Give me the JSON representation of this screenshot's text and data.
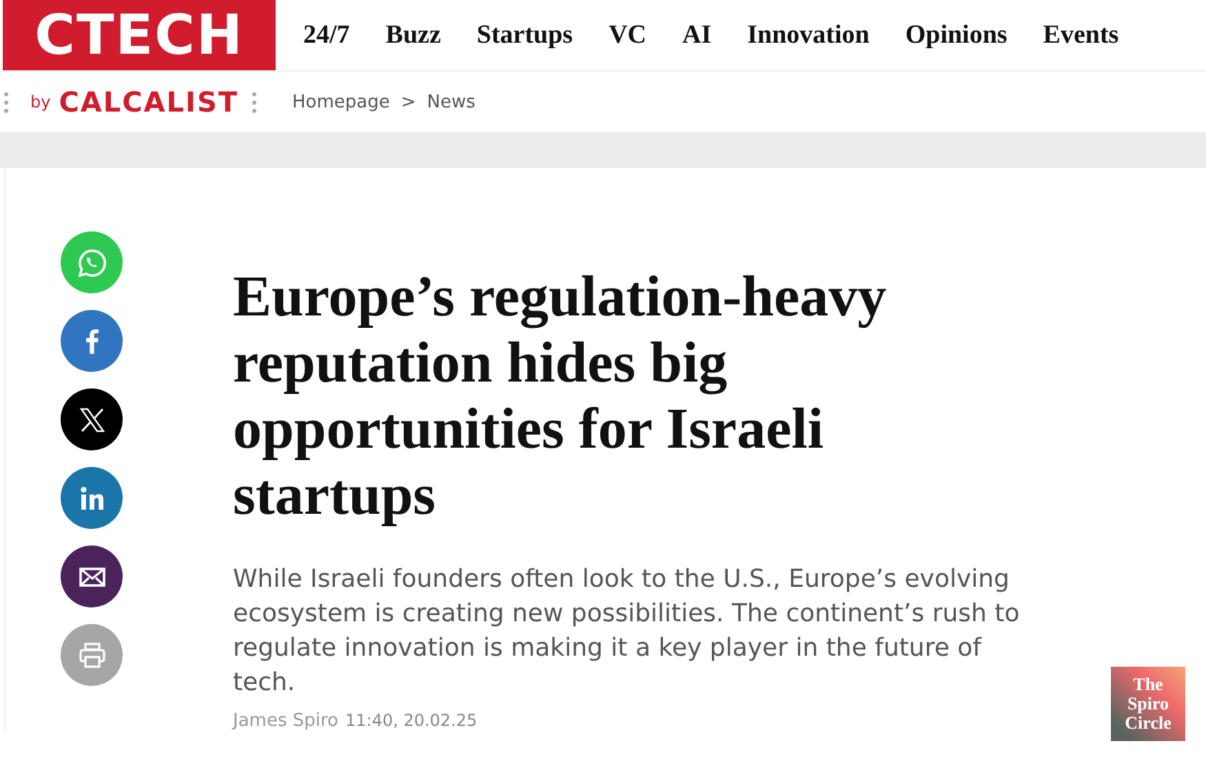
{
  "logo": "CTECH",
  "nav": [
    {
      "label": "24/7"
    },
    {
      "label": "Buzz"
    },
    {
      "label": "Startups"
    },
    {
      "label": "VC"
    },
    {
      "label": "AI"
    },
    {
      "label": "Innovation"
    },
    {
      "label": "Opinions"
    },
    {
      "label": "Events"
    }
  ],
  "brand": {
    "prefix": "by",
    "name": "CALCALIST"
  },
  "breadcrumb": [
    {
      "label": "Homepage"
    },
    {
      "label": ">"
    },
    {
      "label": "News"
    }
  ],
  "share": [
    {
      "kind": "whatsapp",
      "color": "#2dc951"
    },
    {
      "kind": "facebook",
      "color": "#3075c0"
    },
    {
      "kind": "x",
      "color": "#000000"
    },
    {
      "kind": "linkedin",
      "color": "#1a76a8"
    },
    {
      "kind": "email",
      "color": "#4a235a"
    },
    {
      "kind": "print",
      "color": "#a6a6a6"
    }
  ],
  "article": {
    "title": "Europe’s regulation-heavy reputation hides big opportunities for Israeli startups",
    "summary": "While Israeli founders often look to the U.S., Europe’s evolving ecosystem is creating new possibilities. The continent’s rush to regulate innovation is making it a key player in the future of tech.",
    "author": "James Spiro",
    "date": "11:40, 20.02.25"
  },
  "badge": {
    "lines": [
      "The",
      "Spiro",
      "Circle"
    ]
  }
}
